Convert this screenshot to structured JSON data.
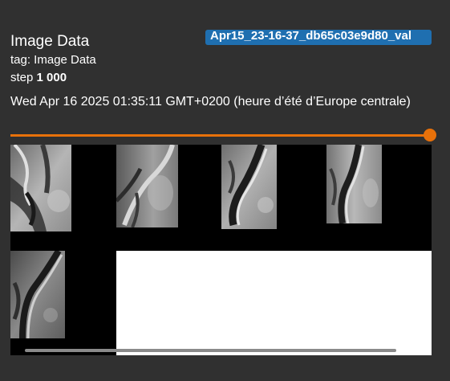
{
  "run": {
    "name": "Apr15_23-16-37_db65c03e9d80_val",
    "color": "#1f6fb0"
  },
  "card": {
    "title": "Image Data",
    "tag_label": "tag: Image Data",
    "step_prefix": "step",
    "step_value": "1 000",
    "timestamp": "Wed Apr 16 2025 01:35:11 GMT+0200 (heure d’été d’Europe centrale)"
  },
  "slider": {
    "accent": "#e8710a",
    "position_fraction": 1.0
  },
  "images": [
    {
      "name": "mri-slice-1"
    },
    {
      "name": "mri-slice-2"
    },
    {
      "name": "mri-slice-3"
    },
    {
      "name": "mri-slice-4"
    },
    {
      "name": "mri-slice-5"
    }
  ]
}
